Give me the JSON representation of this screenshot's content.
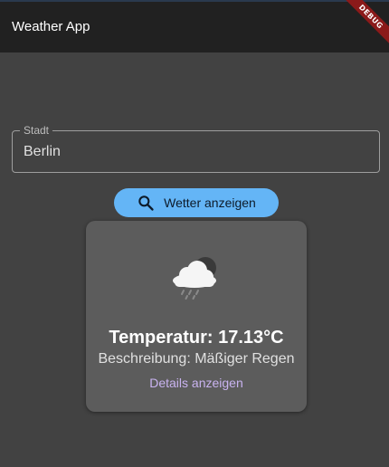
{
  "app_bar": {
    "title": "Weather App",
    "debug_label": "DEBUG"
  },
  "city_field": {
    "label": "Stadt",
    "value": "Berlin"
  },
  "show_button": {
    "label": "Wetter anzeigen",
    "icon": "search-icon"
  },
  "weather_card": {
    "icon": "rain-cloud-icon",
    "temperature": "Temperatur: 17.13°C",
    "description": "Beschreibung: Mäßiger Regen",
    "details_link": "Details anzeigen"
  },
  "colors": {
    "app_bar": "#212121",
    "background": "#424242",
    "button": "#64b5f6",
    "card": "#5c5c5c",
    "link": "#c9b3f0",
    "debug_ribbon": "#8b1a1a"
  }
}
